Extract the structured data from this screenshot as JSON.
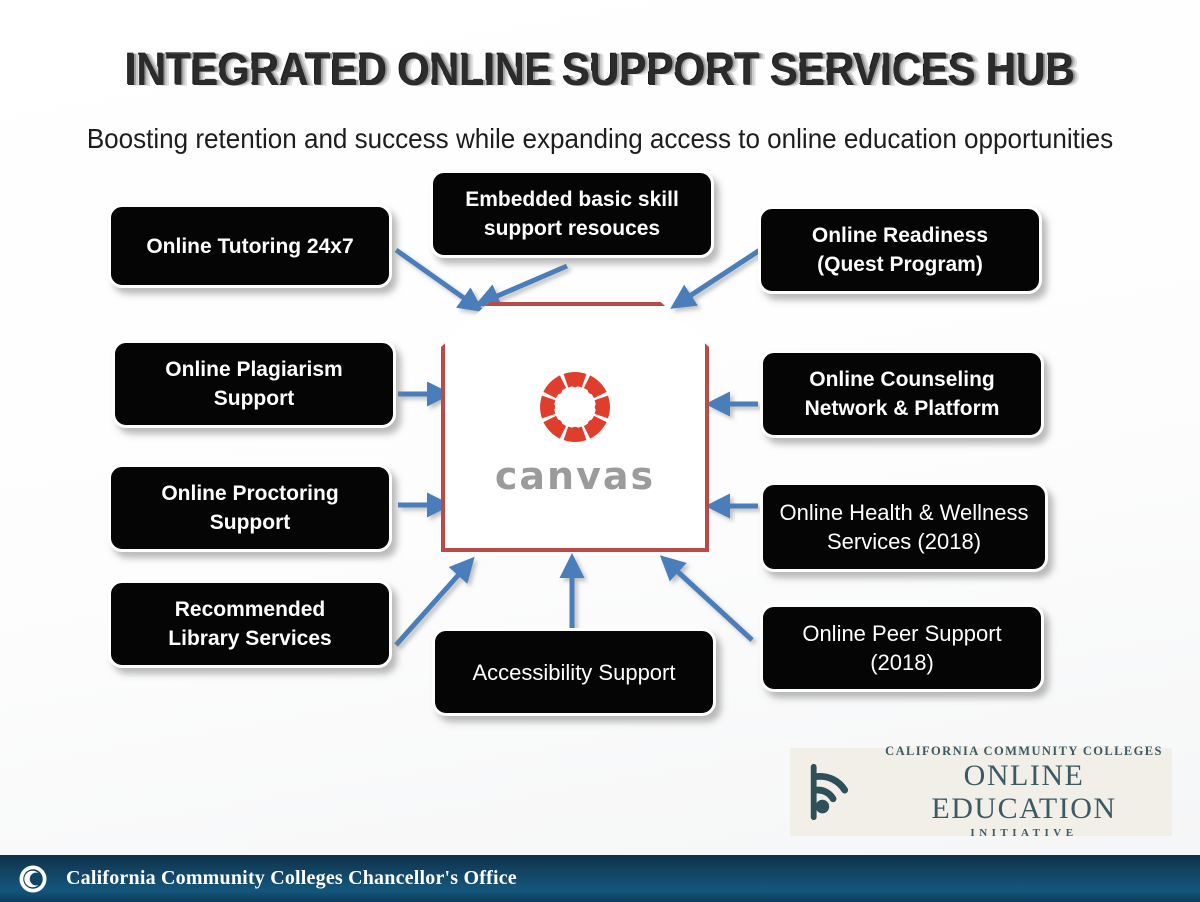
{
  "slide": {
    "title": "INTEGRATED ONLINE SUPPORT SERVICES HUB",
    "subtitle": "Boosting retention and success while expanding access to online education opportunities"
  },
  "hub": {
    "logo_name": "canvas-logo",
    "wordmark": "canvas",
    "border_color": "#b94a48",
    "logo_color": "#e03e2d",
    "wordmark_color": "#9b9b9b"
  },
  "connectors": {
    "color": "#4a7ebb",
    "count": 10
  },
  "nodes": [
    {
      "id": "online-tutoring",
      "label": "Online Tutoring 24x7",
      "weight": "bold"
    },
    {
      "id": "embedded-basic-skill",
      "label": "Embedded basic skill support resouces",
      "weight": "bold"
    },
    {
      "id": "online-readiness",
      "label": "Online Readiness (Quest Program)",
      "weight": "bold"
    },
    {
      "id": "online-plagiarism",
      "label": "Online Plagiarism Support",
      "weight": "bold"
    },
    {
      "id": "online-counseling",
      "label": "Online Counseling Network & Platform",
      "weight": "bold"
    },
    {
      "id": "online-proctoring",
      "label": "Online Proctoring Support",
      "weight": "bold"
    },
    {
      "id": "online-health",
      "label": "Online Health & Wellness Services (2018)",
      "weight": "regular"
    },
    {
      "id": "library-services",
      "label": "Recommended Library Services",
      "weight": "bold"
    },
    {
      "id": "accessibility",
      "label": "Accessibility Support",
      "weight": "regular"
    },
    {
      "id": "online-peer",
      "label": "Online Peer Support (2018)",
      "weight": "regular"
    }
  ],
  "node_lines": {
    "online-tutoring": [
      "Online Tutoring 24x7"
    ],
    "embedded-basic-skill": [
      "Embedded basic skill",
      "support resouces"
    ],
    "online-readiness": [
      "Online Readiness",
      "(Quest Program)"
    ],
    "online-plagiarism": [
      "Online Plagiarism",
      "Support"
    ],
    "online-counseling": [
      "Online Counseling",
      "Network & Platform"
    ],
    "online-proctoring": [
      "Online Proctoring",
      "Support"
    ],
    "online-health": [
      "Online Health & Wellness",
      "Services (2018)"
    ],
    "library-services": [
      "Recommended",
      "Library Services"
    ],
    "accessibility": [
      "Accessibility Support"
    ],
    "online-peer": [
      "Online Peer Support",
      "(2018)"
    ]
  },
  "oei_logo": {
    "icon_name": "wifi-icon",
    "line1": "CALIFORNIA COMMUNITY COLLEGES",
    "line2": "ONLINE EDUCATION",
    "line3": "INITIATIVE",
    "color": "#3c5a63",
    "background": "#f2efe9"
  },
  "footer": {
    "logo_name": "cccco-seal-icon",
    "text": "California Community Colleges Chancellor's Office",
    "background": "#124463"
  }
}
